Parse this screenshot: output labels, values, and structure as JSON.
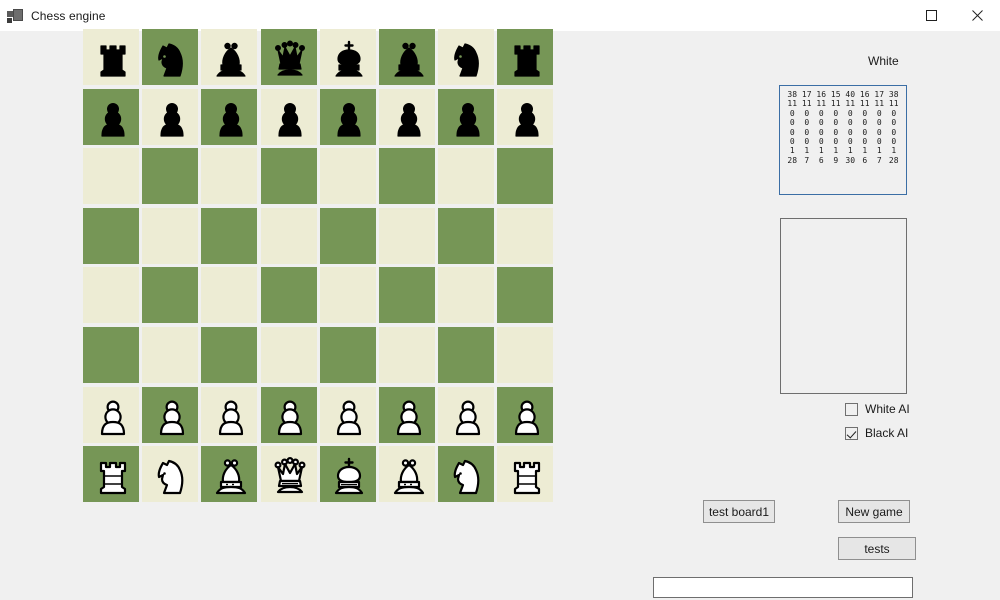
{
  "window": {
    "title": "Chess engine",
    "icon": "app-icon",
    "controls": {
      "maximize": "maximize-icon",
      "close": "close-icon"
    }
  },
  "board": {
    "light_color": "#edecd4",
    "dark_color": "#769656",
    "orientation": "white-bottom",
    "ranks": [
      [
        "r",
        "n",
        "b",
        "q",
        "k",
        "b",
        "n",
        "r"
      ],
      [
        "p",
        "p",
        "p",
        "p",
        "p",
        "p",
        "p",
        "p"
      ],
      [
        "",
        "",
        "",
        "",
        "",
        "",
        "",
        ""
      ],
      [
        "",
        "",
        "",
        "",
        "",
        "",
        "",
        ""
      ],
      [
        "",
        "",
        "",
        "",
        "",
        "",
        "",
        ""
      ],
      [
        "",
        "",
        "",
        "",
        "",
        "",
        "",
        ""
      ],
      [
        "P",
        "P",
        "P",
        "P",
        "P",
        "P",
        "P",
        "P"
      ],
      [
        "R",
        "N",
        "B",
        "Q",
        "K",
        "B",
        "N",
        "R"
      ]
    ]
  },
  "side_panel": {
    "turn_label": "White",
    "value_grid": {
      "border_color": "#3b6ea5",
      "rows": [
        [
          "38",
          "17",
          "16",
          "15",
          "40",
          "16",
          "17",
          "38"
        ],
        [
          "11",
          "11",
          "11",
          "11",
          "11",
          "11",
          "11",
          "11"
        ],
        [
          "0",
          "0",
          "0",
          "0",
          "0",
          "0",
          "0",
          "0"
        ],
        [
          "0",
          "0",
          "0",
          "0",
          "0",
          "0",
          "0",
          "0"
        ],
        [
          "0",
          "0",
          "0",
          "0",
          "0",
          "0",
          "0",
          "0"
        ],
        [
          "0",
          "0",
          "0",
          "0",
          "0",
          "0",
          "0",
          "0"
        ],
        [
          "1",
          "1",
          "1",
          "1",
          "1",
          "1",
          "1",
          "1"
        ],
        [
          "28",
          "7",
          "6",
          "9",
          "30",
          "6",
          "7",
          "28"
        ]
      ]
    },
    "log_panel": {
      "content": ""
    },
    "checkboxes": [
      {
        "label": "White AI",
        "checked": false
      },
      {
        "label": "Black AI",
        "checked": true
      }
    ],
    "buttons": {
      "test_board1": "test board1",
      "new_game": "New game",
      "tests": "tests"
    },
    "command_input": {
      "value": "",
      "placeholder": ""
    }
  }
}
